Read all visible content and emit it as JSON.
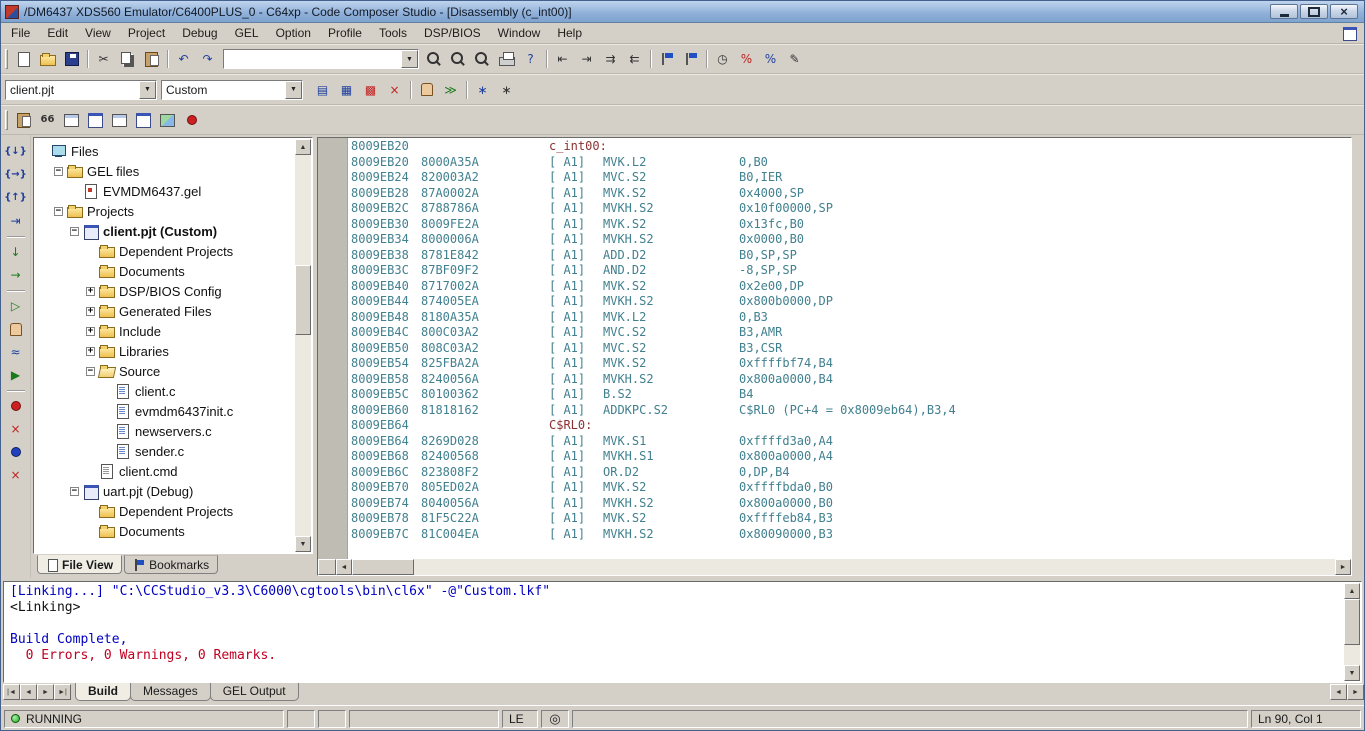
{
  "window": {
    "title": "/DM6437 XDS560 Emulator/C6400PLUS_0 - C64xp - Code Composer Studio - [Disassembly (c_int00)]"
  },
  "icons": {
    "dropdown": "▼",
    "up": "▲",
    "down": "▼",
    "left": "◄",
    "right": "►",
    "close": "×",
    "coil": "◎",
    "tab_first": "|◄",
    "tab_prev": "◄",
    "tab_next": "►",
    "tab_last": "►|"
  },
  "menu": {
    "items": [
      {
        "label": "File",
        "name": "menu-file"
      },
      {
        "label": "Edit",
        "name": "menu-edit"
      },
      {
        "label": "View",
        "name": "menu-view"
      },
      {
        "label": "Project",
        "name": "menu-project"
      },
      {
        "label": "Debug",
        "name": "menu-debug"
      },
      {
        "label": "GEL",
        "name": "menu-gel"
      },
      {
        "label": "Option",
        "name": "menu-option"
      },
      {
        "label": "Profile",
        "name": "menu-profile"
      },
      {
        "label": "Tools",
        "name": "menu-tools"
      },
      {
        "label": "DSP/BIOS",
        "name": "menu-dsp-bios"
      },
      {
        "label": "Window",
        "name": "menu-window"
      },
      {
        "label": "Help",
        "name": "menu-help"
      }
    ]
  },
  "toolbar_standard": {
    "search_value": "",
    "group1": [
      {
        "name": "new-document-button",
        "shape": "page"
      },
      {
        "name": "open-document-button",
        "shape": "folder"
      },
      {
        "name": "save-document-button",
        "shape": "disk"
      },
      {
        "name": "separator",
        "sep": "true",
        "inter": "false"
      },
      {
        "name": "cut-button",
        "glyph": "✂",
        "tone": "dark"
      },
      {
        "name": "copy-button",
        "shape": "copy"
      },
      {
        "name": "paste-button",
        "shape": "paste"
      },
      {
        "name": "separator",
        "sep": "true",
        "inter": "false"
      },
      {
        "name": "undo-button",
        "glyph": "↶",
        "tone": "blue"
      },
      {
        "name": "redo-button",
        "glyph": "↷",
        "tone": "blue"
      }
    ],
    "group2": [
      {
        "name": "find-word-button",
        "shape": "magnifier"
      },
      {
        "name": "find-next-button",
        "shape": "magnifier"
      },
      {
        "name": "find-in-files-button",
        "shape": "magnifier"
      },
      {
        "name": "print-button",
        "shape": "printer"
      },
      {
        "name": "context-help-button",
        "glyph": "?",
        "tone": "blue"
      },
      {
        "name": "separator",
        "sep": "true",
        "inter": "false"
      },
      {
        "name": "shift-left-button",
        "glyph": "⇤",
        "tone": "dark"
      },
      {
        "name": "shift-right-button",
        "glyph": "⇥",
        "tone": "dark"
      },
      {
        "name": "indent-button",
        "glyph": "⇉",
        "tone": "dark"
      },
      {
        "name": "outdent-button",
        "glyph": "⇇",
        "tone": "dark"
      },
      {
        "name": "separator",
        "sep": "true",
        "inter": "false"
      },
      {
        "name": "toggle-bookmark-button",
        "shape": "flag"
      },
      {
        "name": "next-bookmark-button",
        "shape": "flag"
      },
      {
        "name": "separator",
        "sep": "true",
        "inter": "false"
      },
      {
        "name": "profile-clock-button",
        "glyph": "◷",
        "tone": "dark"
      },
      {
        "name": "profile-marker-button",
        "glyph": "%",
        "tone": "red"
      },
      {
        "name": "profile-range-button",
        "glyph": "%",
        "tone": "blue"
      },
      {
        "name": "editor-properties-button",
        "glyph": "✎",
        "tone": "dark"
      }
    ]
  },
  "toolbar_project": {
    "project_value": "client.pjt",
    "config_value": "Custom",
    "buttons": [
      {
        "name": "compile-file-button",
        "glyph": "▤",
        "tone": "blue"
      },
      {
        "name": "incremental-build-button",
        "glyph": "▦",
        "tone": "blue"
      },
      {
        "name": "rebuild-all-button",
        "glyph": "▩",
        "tone": "red"
      },
      {
        "name": "stop-build-button",
        "glyph": "×",
        "tone": "red"
      },
      {
        "name": "separator",
        "sep": "true",
        "inter": "false"
      },
      {
        "name": "halt-button",
        "shape": "hand"
      },
      {
        "name": "animate-button",
        "glyph": "≫",
        "tone": "green"
      },
      {
        "name": "separator",
        "sep": "true",
        "inter": "false"
      },
      {
        "name": "gel-settings-button",
        "glyph": "∗",
        "tone": "blue"
      },
      {
        "name": "dsp-bios-settings-button",
        "glyph": "∗",
        "tone": "dark"
      }
    ]
  },
  "toolbar_windows": {
    "buttons": [
      {
        "name": "workspace-button",
        "shape": "paste"
      },
      {
        "name": "quick-watch-button",
        "glyph": "66",
        "tone": "dark"
      },
      {
        "name": "memory-window-button",
        "shape": "grid"
      },
      {
        "name": "register-window-button",
        "shape": "window"
      },
      {
        "name": "stack-window-button",
        "shape": "grid"
      },
      {
        "name": "watch-window-button",
        "shape": "window"
      },
      {
        "name": "image-window-button",
        "shape": "image"
      },
      {
        "name": "graph-window-button",
        "shape": "dot-red"
      }
    ]
  },
  "debug_toolbar": {
    "buttons": [
      {
        "name": "step-into-button",
        "glyph": "{↓}",
        "tone": "blue"
      },
      {
        "name": "step-over-button",
        "glyph": "{→}",
        "tone": "blue"
      },
      {
        "name": "step-out-button",
        "glyph": "{↑}",
        "tone": "blue"
      },
      {
        "name": "run-to-cursor-button",
        "glyph": "⇥",
        "tone": "blue"
      },
      {
        "name": "separator",
        "sep": "true",
        "inter": "false"
      },
      {
        "name": "asm-step-into-button",
        "glyph": "↓",
        "tone": "green"
      },
      {
        "name": "asm-step-over-button",
        "glyph": "→",
        "tone": "green"
      },
      {
        "name": "separator",
        "sep": "true",
        "inter": "false"
      },
      {
        "name": "run-button",
        "glyph": "▷",
        "tone": "green"
      },
      {
        "name": "halt-processor-button",
        "shape": "hand"
      },
      {
        "name": "animate-button",
        "glyph": "≈",
        "tone": "blue"
      },
      {
        "name": "run-free-button",
        "glyph": "▶",
        "tone": "green"
      },
      {
        "name": "separator",
        "sep": "true",
        "inter": "false"
      },
      {
        "name": "toggle-breakpoint-button",
        "shape": "dot-red"
      },
      {
        "name": "remove-all-breakpoints-button",
        "glyph": "×",
        "tone": "red"
      },
      {
        "name": "toggle-probe-point-button",
        "shape": "dot-blue"
      },
      {
        "name": "remove-all-probe-points-button",
        "glyph": "×",
        "tone": "red"
      }
    ]
  },
  "sidebar": {
    "tree": [
      {
        "label": "Files",
        "level": 0,
        "exp": "none",
        "icon": "computer"
      },
      {
        "label": "GEL files",
        "level": 1,
        "exp": "minus",
        "icon": "folder"
      },
      {
        "label": "EVMDM6437.gel",
        "level": 2,
        "exp": "none",
        "icon": "gel"
      },
      {
        "label": "Projects",
        "level": 1,
        "exp": "minus",
        "icon": "folder"
      },
      {
        "label": "client.pjt (Custom)",
        "level": 2,
        "exp": "minus",
        "icon": "project",
        "bold": "true"
      },
      {
        "label": "Dependent Projects",
        "level": 3,
        "exp": "none",
        "icon": "folder"
      },
      {
        "label": "Documents",
        "level": 3,
        "exp": "none",
        "icon": "folder"
      },
      {
        "label": "DSP/BIOS Config",
        "level": 3,
        "exp": "plus",
        "icon": "folder"
      },
      {
        "label": "Generated Files",
        "level": 3,
        "exp": "plus",
        "icon": "folder"
      },
      {
        "label": "Include",
        "level": 3,
        "exp": "plus",
        "icon": "folder"
      },
      {
        "label": "Libraries",
        "level": 3,
        "exp": "plus",
        "icon": "folder"
      },
      {
        "label": "Source",
        "level": 3,
        "exp": "minus",
        "icon": "folder-open"
      },
      {
        "label": "client.c",
        "level": 4,
        "exp": "none",
        "icon": "cfile"
      },
      {
        "label": "evmdm6437init.c",
        "level": 4,
        "exp": "none",
        "icon": "cfile"
      },
      {
        "label": "newservers.c",
        "level": 4,
        "exp": "none",
        "icon": "cfile"
      },
      {
        "label": "sender.c",
        "level": 4,
        "exp": "none",
        "icon": "cfile"
      },
      {
        "label": "client.cmd",
        "level": 3,
        "exp": "none",
        "icon": "cmdfile"
      },
      {
        "label": "uart.pjt (Debug)",
        "level": 2,
        "exp": "minus",
        "icon": "project"
      },
      {
        "label": "Dependent Projects",
        "level": 3,
        "exp": "none",
        "icon": "folder"
      },
      {
        "label": "Documents",
        "level": 3,
        "exp": "none",
        "icon": "folder"
      }
    ],
    "tabs": [
      {
        "label": "File View",
        "name": "tab-file-view",
        "icon": "page",
        "active": "true"
      },
      {
        "label": "Bookmarks",
        "name": "tab-bookmarks",
        "icon": "flag",
        "active": "false"
      }
    ]
  },
  "disassembly": {
    "lines": [
      {
        "addr": "8009EB20",
        "label": "c_int00:"
      },
      {
        "addr": "8009EB20",
        "code": "8000A35A",
        "pred": "[ A1]",
        "mn": "MVK.L2",
        "ops": "0,B0"
      },
      {
        "addr": "8009EB24",
        "code": "820003A2",
        "pred": "[ A1]",
        "mn": "MVC.S2",
        "ops": "B0,IER"
      },
      {
        "addr": "8009EB28",
        "code": "87A0002A",
        "pred": "[ A1]",
        "mn": "MVK.S2",
        "ops": "0x4000,SP"
      },
      {
        "addr": "8009EB2C",
        "code": "8788786A",
        "pred": "[ A1]",
        "mn": "MVKH.S2",
        "ops": "0x10f00000,SP"
      },
      {
        "addr": "8009EB30",
        "code": "8009FE2A",
        "pred": "[ A1]",
        "mn": "MVK.S2",
        "ops": "0x13fc,B0"
      },
      {
        "addr": "8009EB34",
        "code": "8000006A",
        "pred": "[ A1]",
        "mn": "MVKH.S2",
        "ops": "0x0000,B0"
      },
      {
        "addr": "8009EB38",
        "code": "8781E842",
        "pred": "[ A1]",
        "mn": "ADD.D2",
        "ops": "B0,SP,SP"
      },
      {
        "addr": "8009EB3C",
        "code": "87BF09F2",
        "pred": "[ A1]",
        "mn": "AND.D2",
        "ops": "-8,SP,SP"
      },
      {
        "addr": "8009EB40",
        "code": "8717002A",
        "pred": "[ A1]",
        "mn": "MVK.S2",
        "ops": "0x2e00,DP"
      },
      {
        "addr": "8009EB44",
        "code": "874005EA",
        "pred": "[ A1]",
        "mn": "MVKH.S2",
        "ops": "0x800b0000,DP"
      },
      {
        "addr": "8009EB48",
        "code": "8180A35A",
        "pred": "[ A1]",
        "mn": "MVK.L2",
        "ops": "0,B3"
      },
      {
        "addr": "8009EB4C",
        "code": "800C03A2",
        "pred": "[ A1]",
        "mn": "MVC.S2",
        "ops": "B3,AMR"
      },
      {
        "addr": "8009EB50",
        "code": "808C03A2",
        "pred": "[ A1]",
        "mn": "MVC.S2",
        "ops": "B3,CSR"
      },
      {
        "addr": "8009EB54",
        "code": "825FBA2A",
        "pred": "[ A1]",
        "mn": "MVK.S2",
        "ops": "0xffffbf74,B4"
      },
      {
        "addr": "8009EB58",
        "code": "8240056A",
        "pred": "[ A1]",
        "mn": "MVKH.S2",
        "ops": "0x800a0000,B4"
      },
      {
        "addr": "8009EB5C",
        "code": "80100362",
        "pred": "[ A1]",
        "mn": "B.S2",
        "ops": "B4"
      },
      {
        "addr": "8009EB60",
        "code": "81818162",
        "pred": "[ A1]",
        "mn": "ADDKPC.S2",
        "ops": "C$RL0 (PC+4 = 0x8009eb64),B3,4"
      },
      {
        "addr": "8009EB64",
        "label": "C$RL0:"
      },
      {
        "addr": "8009EB64",
        "code": "8269D028",
        "pred": "[ A1]",
        "mn": "MVK.S1",
        "ops": "0xffffd3a0,A4"
      },
      {
        "addr": "8009EB68",
        "code": "82400568",
        "pred": "[ A1]",
        "mn": "MVKH.S1",
        "ops": "0x800a0000,A4"
      },
      {
        "addr": "8009EB6C",
        "code": "823808F2",
        "pred": "[ A1]",
        "mn": "OR.D2",
        "ops": "0,DP,B4"
      },
      {
        "addr": "8009EB70",
        "code": "805ED02A",
        "pred": "[ A1]",
        "mn": "MVK.S2",
        "ops": "0xffffbda0,B0"
      },
      {
        "addr": "8009EB74",
        "code": "8040056A",
        "pred": "[ A1]",
        "mn": "MVKH.S2",
        "ops": "0x800a0000,B0"
      },
      {
        "addr": "8009EB78",
        "code": "81F5C22A",
        "pred": "[ A1]",
        "mn": "MVK.S2",
        "ops": "0xffffeb84,B3"
      },
      {
        "addr": "8009EB7C",
        "code": "81C004EA",
        "pred": "[ A1]",
        "mn": "MVKH.S2",
        "ops": "0x80090000,B3"
      }
    ]
  },
  "output": {
    "lines": [
      {
        "text": "[Linking...] \"C:\\CCStudio_v3.3\\C6000\\cgtools\\bin\\cl6x\" -@\"Custom.lkf\"",
        "color": "blue"
      },
      {
        "text": "<Linking>",
        "color": "black"
      },
      {
        "text": "",
        "color": "black"
      },
      {
        "text": "Build Complete,",
        "color": "blue"
      },
      {
        "text": "  0 Errors, 0 Warnings, 0 Remarks.",
        "color": "red"
      }
    ],
    "tabs": [
      {
        "label": "Build",
        "name": "tab-build",
        "active": "true"
      },
      {
        "label": "Messages",
        "name": "tab-messages",
        "active": "false"
      },
      {
        "label": "GEL Output",
        "name": "tab-gel-output",
        "active": "false"
      }
    ]
  },
  "statusbar": {
    "status": "RUNNING",
    "endian": "LE",
    "cursor": "Ln 90, Col 1"
  }
}
